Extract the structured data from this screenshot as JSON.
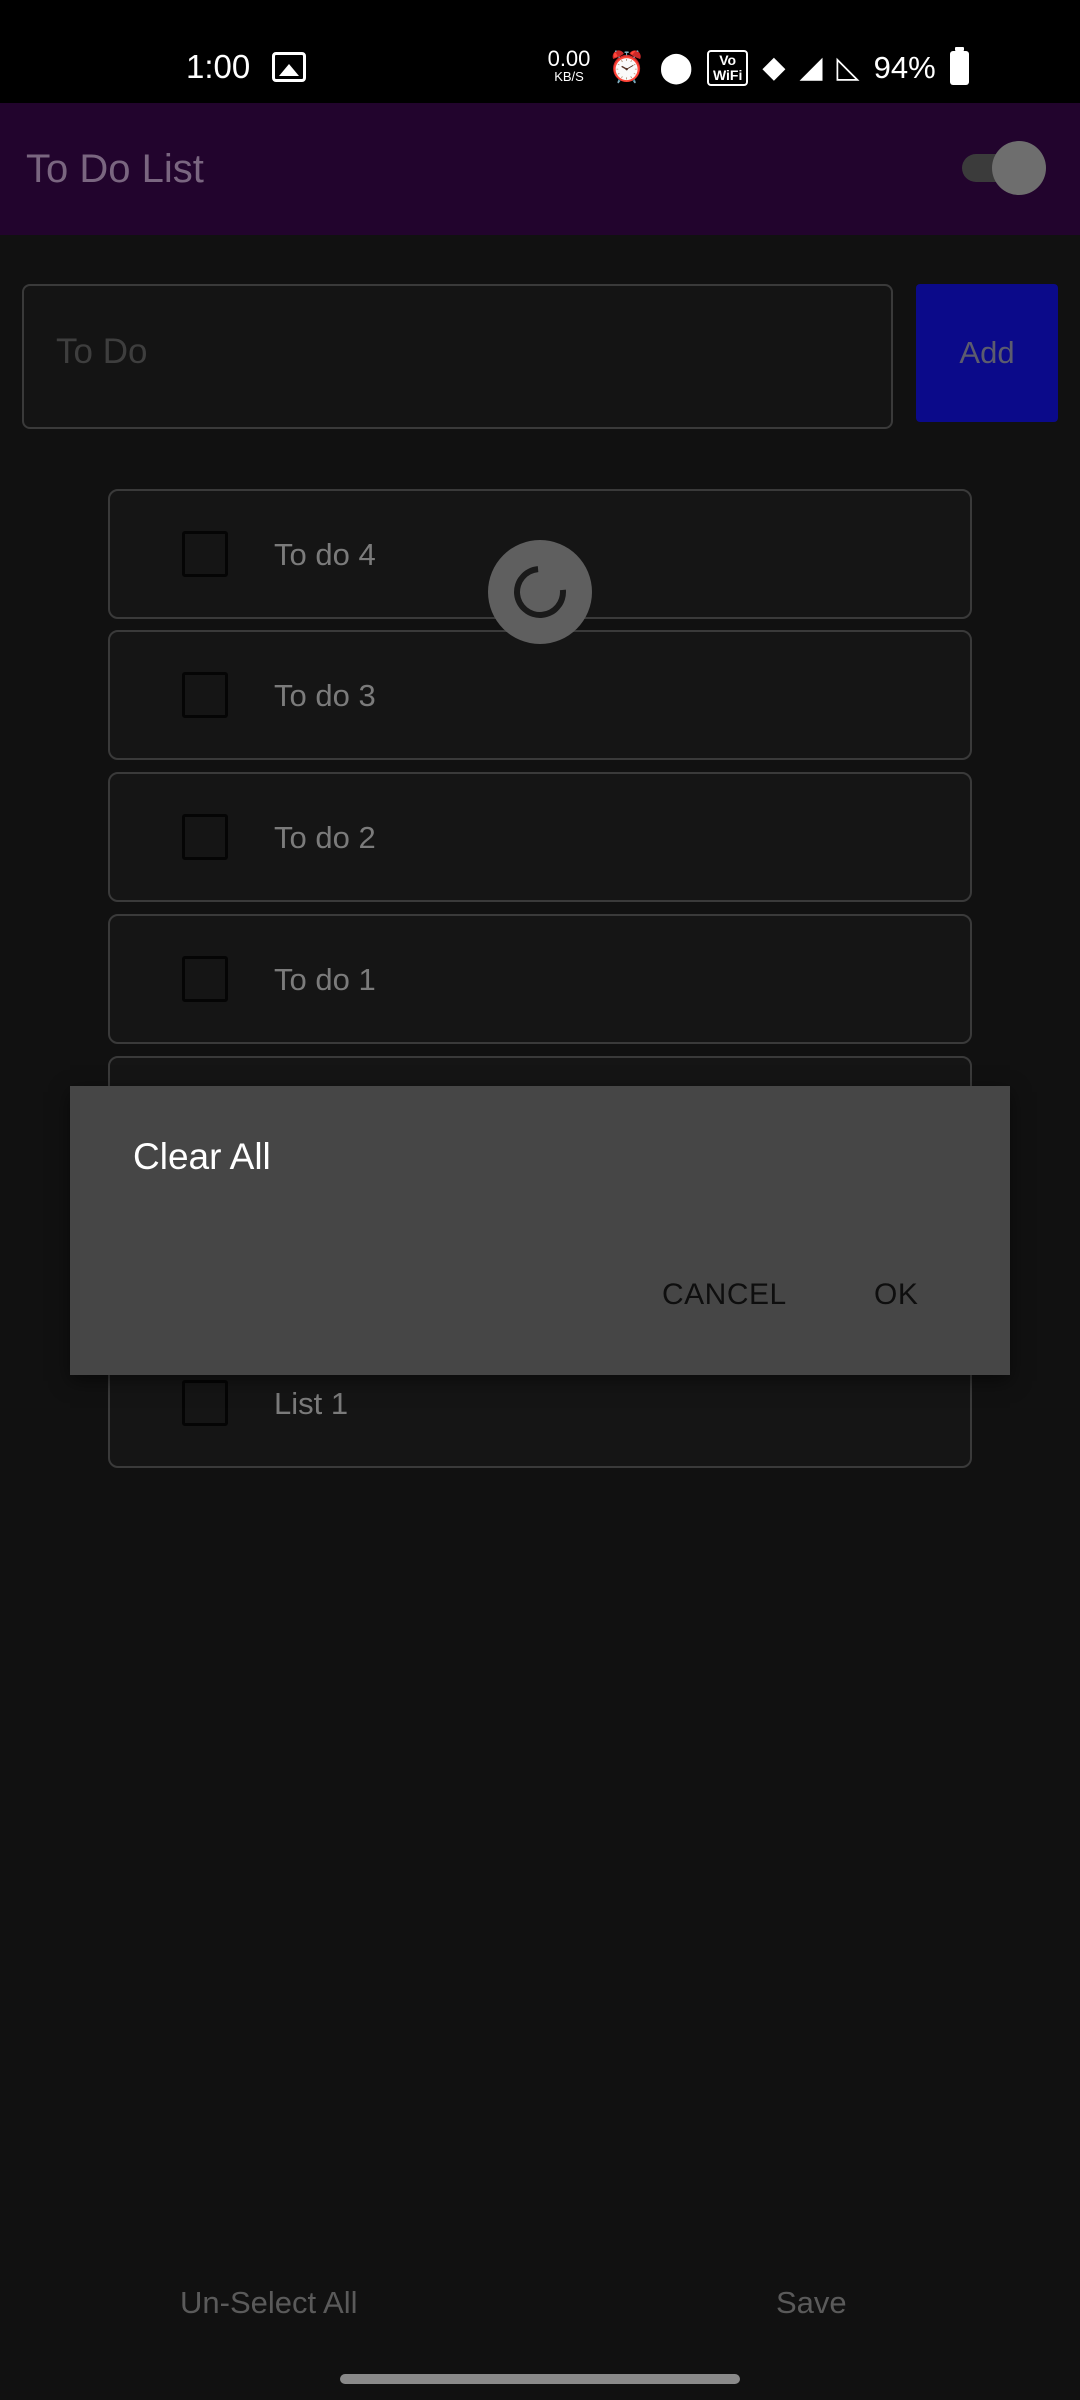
{
  "status_bar": {
    "time": "1:00",
    "net_speed_value": "0.00",
    "net_speed_unit": "KB/S",
    "wifi_calling_label": "Vo\nWiFi",
    "battery_percent": "94%",
    "icons": [
      "gallery-icon",
      "alarm-icon",
      "location-icon",
      "wifi-calling-icon",
      "wifi-icon",
      "signal-icon",
      "signal-no-service-icon",
      "battery-icon"
    ]
  },
  "app_bar": {
    "title": "To Do List",
    "toggle_state": "on"
  },
  "input": {
    "placeholder": "To Do",
    "add_label": "Add"
  },
  "list": {
    "items": [
      {
        "label": "To do 4",
        "checked": false
      },
      {
        "label": "To do 3",
        "checked": false
      },
      {
        "label": "To do 2",
        "checked": false
      },
      {
        "label": "To do 1",
        "checked": false
      },
      {
        "label": "",
        "checked": false
      },
      {
        "label": "",
        "checked": false
      },
      {
        "label": "List 1",
        "checked": false
      }
    ]
  },
  "dialog": {
    "title": "Clear All",
    "cancel_label": "CANCEL",
    "ok_label": "OK"
  },
  "bottom": {
    "unselect_all_label": "Un-Select All",
    "save_label": "Save"
  },
  "colors": {
    "app_bar": "#22042d",
    "add_button": "#0b0a8a",
    "background": "#111111",
    "dialog": "#464646"
  }
}
